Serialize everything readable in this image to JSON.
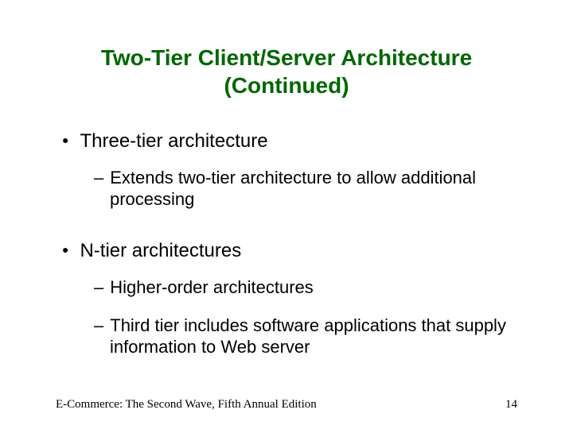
{
  "title_line1": "Two-Tier Client/Server Architecture",
  "title_line2": "(Continued)",
  "bullets": {
    "b1": "Three-tier architecture",
    "b1_1": "Extends two-tier architecture to allow additional processing",
    "b2": "N-tier architectures",
    "b2_1": "Higher-order architectures",
    "b2_2": "Third tier includes software applications that supply information to Web server"
  },
  "footer_left": "E-Commerce: The Second Wave, Fifth Annual Edition",
  "footer_right": "14"
}
